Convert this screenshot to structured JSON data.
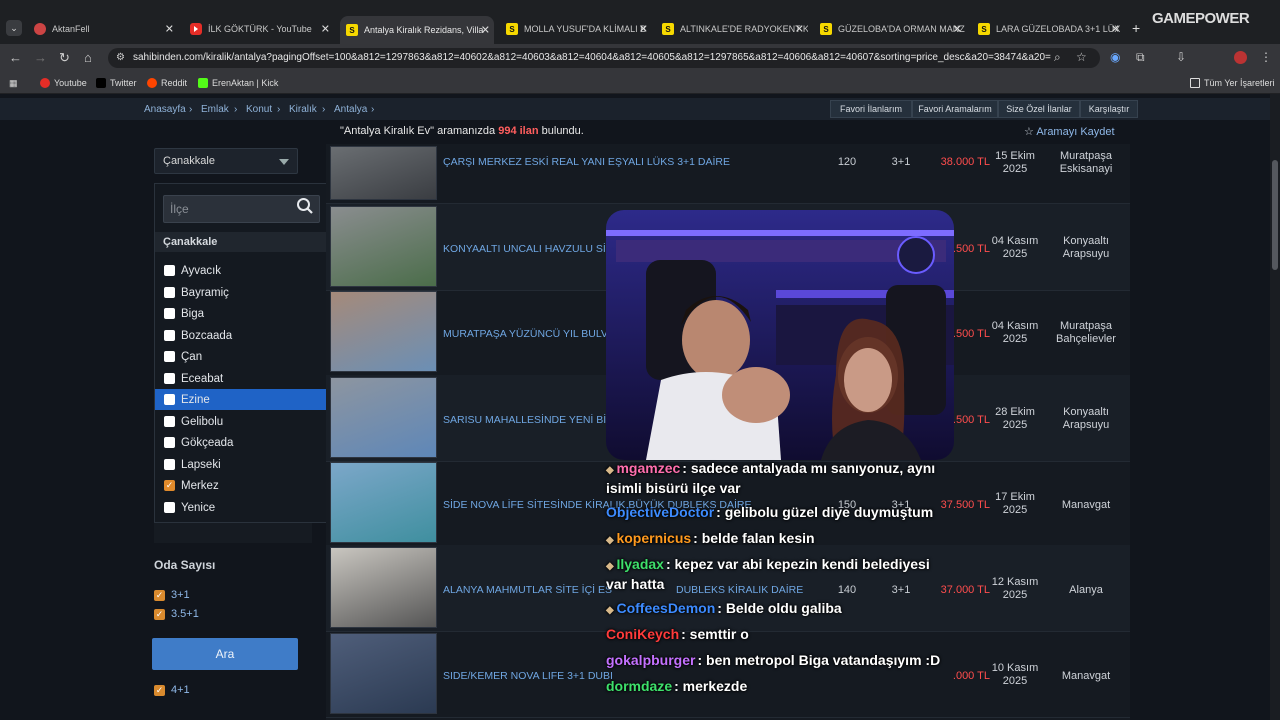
{
  "browser": {
    "tabs": [
      {
        "title": "AktanFell",
        "icon": "globe-icon"
      },
      {
        "title": "İLK GÖKTÜRK - YouTube",
        "icon": "youtube-icon"
      },
      {
        "title": "Antalya Kiralık Rezidans, Villa",
        "icon": "sahibinden-icon"
      },
      {
        "title": "MOLLA YUSUF'DA KLİMALI B",
        "icon": "sahibinden-icon"
      },
      {
        "title": "ALTINKALE'DE RADYOKENT K",
        "icon": "sahibinden-icon"
      },
      {
        "title": "GÜZELOBA'DA ORMAN MANZ",
        "icon": "sahibinden-icon"
      },
      {
        "title": "LARA GÜZELOBADA 3+1 LÜX",
        "icon": "sahibinden-icon"
      }
    ],
    "url": "sahibinden.com/kiralik/antalya?pagingOffset=100&a812=1297863&a812=40602&a812=40603&a812=40604&a812=40605&a812=1297865&a812=40606&a812=40607&sorting=price_desc&a20=38474&a20=12...",
    "bookmarks": [
      "Youtube",
      "Twitter",
      "Reddit",
      "ErenAktan | Kick"
    ],
    "all_bookmarks": "Tüm Yer İşaretleri",
    "overlay_logo": "GAMEPOWER"
  },
  "breadcrumb": [
    "Anasayfa",
    "Emlak",
    "Konut",
    "Kiralık",
    "Antalya"
  ],
  "quick_links": [
    "Favori İlanlarım",
    "Favori Aramalarım",
    "Size Özel İlanlar",
    "Karşılaştır"
  ],
  "search_summary": {
    "query": "\"Antalya Kiralık Ev\"",
    "middle": " aramanızda ",
    "count": "994 ilan",
    "suffix": " bulundu."
  },
  "save_search": "Aramayı Kaydet",
  "filters": {
    "city": "Çanakkale",
    "district_placeholder": "İlçe",
    "group_header": "Çanakkale",
    "districts": [
      {
        "name": "Ayvacık",
        "checked": false
      },
      {
        "name": "Bayramiç",
        "checked": false
      },
      {
        "name": "Biga",
        "checked": false
      },
      {
        "name": "Bozcaada",
        "checked": false
      },
      {
        "name": "Çan",
        "checked": false
      },
      {
        "name": "Eceabat",
        "checked": false
      },
      {
        "name": "Ezine",
        "checked": false,
        "highlighted": true
      },
      {
        "name": "Gelibolu",
        "checked": false
      },
      {
        "name": "Gökçeada",
        "checked": false
      },
      {
        "name": "Lapseki",
        "checked": false
      },
      {
        "name": "Merkez",
        "checked": true
      },
      {
        "name": "Yenice",
        "checked": false
      }
    ],
    "room_header": "Oda Sayısı",
    "rooms": [
      "3+1",
      "3.5+1",
      "4+1"
    ],
    "search_button": "Ara"
  },
  "listings": [
    {
      "title": "ÇARŞI MERKEZ ESKİ REAL YANI EŞYALI LÜKS 3+1 DAİRE",
      "m2": "120",
      "rooms": "3+1",
      "price": "38.000 TL",
      "date": [
        "15 Ekim",
        "2025"
      ],
      "location": [
        "Muratpaşa",
        "Eskisanayi"
      ]
    },
    {
      "title": "KONYAALTI UNCALI HAVZULU SİTE",
      "m2": "",
      "rooms": "",
      "price": ".500 TL",
      "date": [
        "04 Kasım",
        "2025"
      ],
      "location": [
        "Konyaaltı",
        "Arapsuyu"
      ]
    },
    {
      "title": "MURATPAŞA YÜZÜNCÜ YIL BULVAR",
      "m2": "",
      "rooms": "",
      "price": ".500 TL",
      "date": [
        "04 Kasım",
        "2025"
      ],
      "location": [
        "Muratpaşa",
        "Bahçelievler"
      ]
    },
    {
      "title": "SARISU MAHALLESİNDE YENİ BİNA",
      "m2": "",
      "rooms": "",
      "price": ".500 TL",
      "date": [
        "28 Ekim",
        "2025"
      ],
      "location": [
        "Konyaaltı",
        "Arapsuyu"
      ]
    },
    {
      "title": "SİDE NOVA LİFE SİTESİNDE KİRALIK BÜYÜK DUBLEKS DAİRE",
      "m2": "150",
      "rooms": "3+1",
      "price": "37.500 TL",
      "date": [
        "17 Ekim",
        "2025"
      ],
      "location": [
        "Manavgat"
      ]
    },
    {
      "title": "ALANYA MAHMUTLAR SİTE İÇİ ES",
      "title_tail": "DUBLEKS KİRALIK DAİRE",
      "m2": "140",
      "rooms": "3+1",
      "price": "37.000 TL",
      "date": [
        "12 Kasım",
        "2025"
      ],
      "location": [
        "Alanya"
      ]
    },
    {
      "title": "SIDE/KEMER NOVA LIFE 3+1 DUBI",
      "m2": "",
      "rooms": "",
      "price": ".000 TL",
      "date": [
        "10 Kasım",
        "2025"
      ],
      "location": [
        "Manavgat"
      ]
    }
  ],
  "chat": [
    {
      "user": "mgamzec",
      "color": "#ff6fae",
      "msg": ": sadece antalyada mı sanıyonuz, aynı",
      "cont": "isimli bisürü ilçe var"
    },
    {
      "user": "ObjectiveDoctor",
      "color": "#3d8bff",
      "msg": ": gelibolu güzel diye duymuştum"
    },
    {
      "user": "kopernicus",
      "color": "#ff9a1f",
      "msg": ": belde falan kesin"
    },
    {
      "user": "Ilyadax",
      "color": "#3ee06b",
      "msg": ": kepez var abi kepezin kendi belediyesi",
      "cont": "var hatta"
    },
    {
      "user": "CoffeesDemon",
      "color": "#3d8bff",
      "msg": ": Belde oldu galiba"
    },
    {
      "user": "ConiKeych",
      "color": "#ff3b3b",
      "msg": ": semttir o"
    },
    {
      "user": "gokalpburger",
      "color": "#c471ff",
      "msg": ": ben metropol Biga vatandaşıyım :D"
    },
    {
      "user": "dormdaze",
      "color": "#3ee06b",
      "msg": ": merkezde"
    }
  ]
}
